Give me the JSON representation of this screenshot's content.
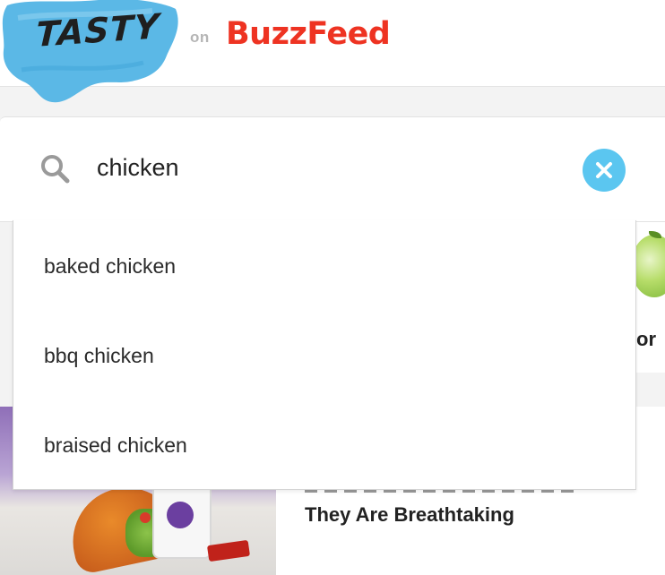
{
  "header": {
    "logo_text": "TASTY",
    "on_text": "on",
    "brand_text": "BuzzFeed",
    "logo_color": "#5bb8e6",
    "brand_color": "#ee3322"
  },
  "search": {
    "value": "chicken",
    "icon": "search-icon",
    "clear_icon": "clear-icon",
    "clear_color": "#5bc6f0"
  },
  "suggestions": [
    {
      "label": "baked chicken"
    },
    {
      "label": "bbq chicken"
    },
    {
      "label": "braised chicken"
    }
  ],
  "background": {
    "right_card_fragment": "or",
    "article_title": "They Are Breathtaking"
  }
}
